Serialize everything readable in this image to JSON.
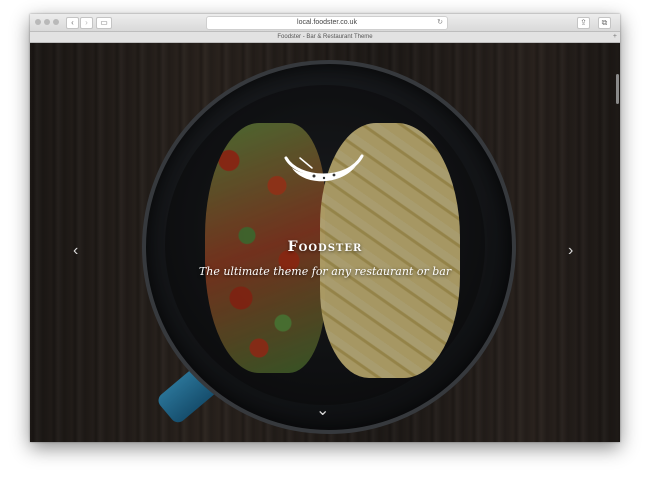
{
  "browser": {
    "url": "local.foodster.co.uk",
    "tab_title": "Foodster - Bar & Restaurant Theme"
  },
  "icons": {
    "back": "‹",
    "forward": "›",
    "sidebar": "▭",
    "reload": "↻",
    "share": "⇪",
    "tabs": "⧉",
    "new_tab": "+",
    "prev_slide": "‹",
    "next_slide": "›",
    "scroll_down": "⌄"
  },
  "hero": {
    "title": "Foodster",
    "tagline": "The ultimate theme for any restaurant or bar"
  }
}
